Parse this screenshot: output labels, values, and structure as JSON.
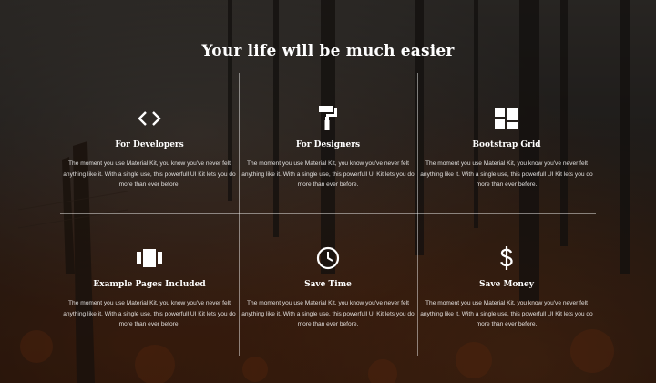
{
  "section": {
    "title": "Your life will be much easier"
  },
  "features": [
    {
      "icon": "code-icon",
      "title": "For Developers",
      "description": "The moment you use Material Kit, you know you've never felt anything like it. With a single use, this powerfull UI Kit lets you do more than ever before."
    },
    {
      "icon": "paint-roller-icon",
      "title": "For Designers",
      "description": "The moment you use Material Kit, you know you've never felt anything like it. With a single use, this powerfull UI Kit lets you do more than ever before."
    },
    {
      "icon": "grid-icon",
      "title": "Bootstrap Grid",
      "description": "The moment you use Material Kit, you know you've never felt anything like it. With a single use, this powerfull UI Kit lets you do more than ever before."
    },
    {
      "icon": "view-carousel-icon",
      "title": "Example Pages Included",
      "description": "The moment you use Material Kit, you know you've never felt anything like it. With a single use, this powerfull UI Kit lets you do more than ever before."
    },
    {
      "icon": "clock-icon",
      "title": "Save Time",
      "description": "The moment you use Material Kit, you know you've never felt anything like it. With a single use, this powerfull UI Kit lets you do more than ever before."
    },
    {
      "icon": "dollar-icon",
      "title": "Save Money",
      "description": "The moment you use Material Kit, you know you've never felt anything like it. With a single use, this powerfull UI Kit lets you do more than ever before."
    }
  ]
}
